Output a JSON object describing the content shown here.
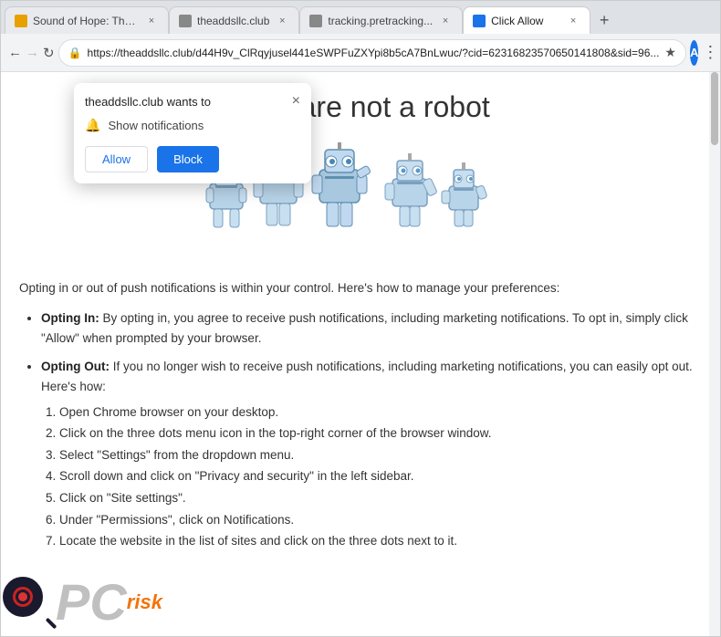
{
  "browser": {
    "tabs": [
      {
        "id": "tab1",
        "title": "Sound of Hope: The...",
        "favicon_color": "#4285f4",
        "active": false
      },
      {
        "id": "tab2",
        "title": "theaddsllc.club",
        "favicon_color": "#888",
        "active": false
      },
      {
        "id": "tab3",
        "title": "tracking.pretracking...",
        "favicon_color": "#888",
        "active": false
      },
      {
        "id": "tab4",
        "title": "Click Allow",
        "favicon_color": "#1a73e8",
        "active": true
      }
    ],
    "new_tab_label": "+",
    "address": "https://theaddsllc.club/d44H9v_ClRqyjusel441eSWPFuZXYpi8b5cA7BnLwuc/?cid=62316823570650141808&sid=96...",
    "back_disabled": false,
    "forward_disabled": true
  },
  "notification_popup": {
    "title": "theaddsllc.club wants to",
    "close_icon": "×",
    "notification_icon": "🔔",
    "notification_label": "Show notifications",
    "allow_label": "Allow",
    "block_label": "Block"
  },
  "page": {
    "heading": "if you are not   a robot",
    "body_intro": "Opting in or out of push notifications is within your control. Here's how to manage your preferences:",
    "list_items": [
      {
        "bold": "Opting In:",
        "text": " By opting in, you agree to receive push notifications, including marketing notifications. To opt in, simply click \"Allow\" when prompted by your browser."
      },
      {
        "bold": "Opting Out:",
        "text": " If you no longer wish to receive push notifications, including marketing notifications, you can easily opt out. Here's how:",
        "sub_items": [
          "Open Chrome browser on your desktop.",
          "Click on the three dots menu icon in the top-right corner of the browser window.",
          "Select \"Settings\" from the dropdown menu.",
          "Scroll down and click on \"Privacy and security\" in the left sidebar.",
          "Click on \"Site settings\".",
          "Under \"Permissions\", click on Notifications.",
          "Locate the website in the list of sites and click on the three dots next to it."
        ]
      }
    ]
  },
  "logo": {
    "pc_text": "PC",
    "risk_text": "risk"
  }
}
